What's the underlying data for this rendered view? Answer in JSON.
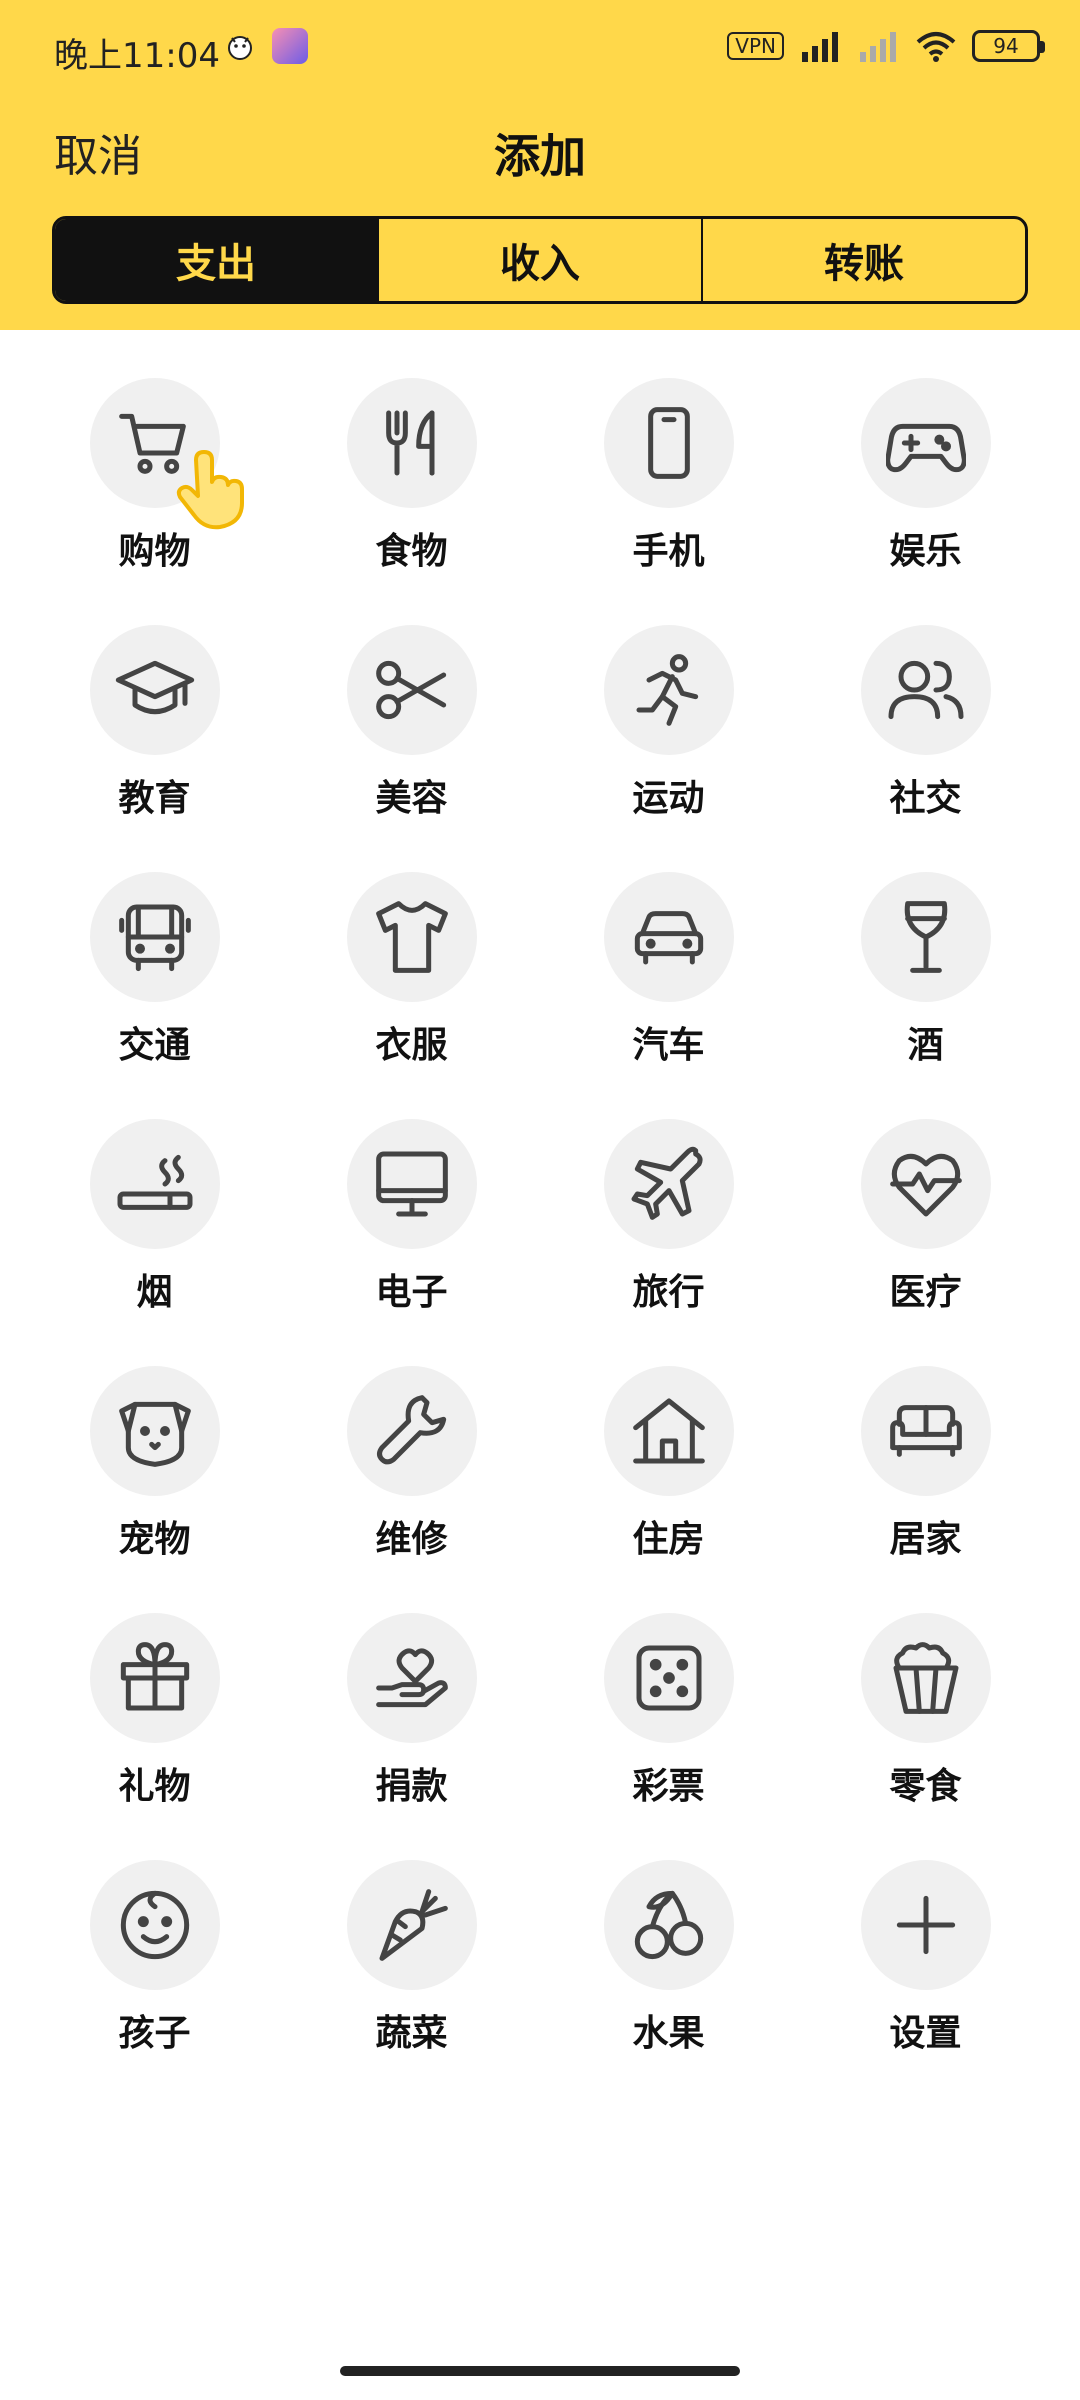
{
  "status_bar": {
    "time": "晚上11:04",
    "vpn": "VPN",
    "battery": "94"
  },
  "nav": {
    "cancel": "取消",
    "title": "添加"
  },
  "tabs": [
    {
      "label": "支出",
      "active": true
    },
    {
      "label": "收入",
      "active": false
    },
    {
      "label": "转账",
      "active": false
    }
  ],
  "categories": [
    {
      "label": "购物",
      "icon": "cart-icon"
    },
    {
      "label": "食物",
      "icon": "fork-knife-icon"
    },
    {
      "label": "手机",
      "icon": "phone-icon"
    },
    {
      "label": "娱乐",
      "icon": "gamepad-icon"
    },
    {
      "label": "教育",
      "icon": "graduation-cap-icon"
    },
    {
      "label": "美容",
      "icon": "scissors-icon"
    },
    {
      "label": "运动",
      "icon": "running-icon"
    },
    {
      "label": "社交",
      "icon": "users-icon"
    },
    {
      "label": "交通",
      "icon": "bus-icon"
    },
    {
      "label": "衣服",
      "icon": "shirt-icon"
    },
    {
      "label": "汽车",
      "icon": "car-icon"
    },
    {
      "label": "酒",
      "icon": "wine-glass-icon"
    },
    {
      "label": "烟",
      "icon": "cigarette-icon"
    },
    {
      "label": "电子",
      "icon": "monitor-icon"
    },
    {
      "label": "旅行",
      "icon": "airplane-icon"
    },
    {
      "label": "医疗",
      "icon": "heartbeat-icon"
    },
    {
      "label": "宠物",
      "icon": "dog-icon"
    },
    {
      "label": "维修",
      "icon": "wrench-icon"
    },
    {
      "label": "住房",
      "icon": "house-icon"
    },
    {
      "label": "居家",
      "icon": "sofa-icon"
    },
    {
      "label": "礼物",
      "icon": "gift-icon"
    },
    {
      "label": "捐款",
      "icon": "donation-icon"
    },
    {
      "label": "彩票",
      "icon": "dice-icon"
    },
    {
      "label": "零食",
      "icon": "popcorn-icon"
    },
    {
      "label": "孩子",
      "icon": "baby-icon"
    },
    {
      "label": "蔬菜",
      "icon": "carrot-icon"
    },
    {
      "label": "水果",
      "icon": "cherry-icon"
    },
    {
      "label": "设置",
      "icon": "plus-icon"
    }
  ],
  "colors": {
    "accent": "#FFD84A",
    "dark": "#111111",
    "circle": "#F0F0F0",
    "icon": "#444444"
  }
}
